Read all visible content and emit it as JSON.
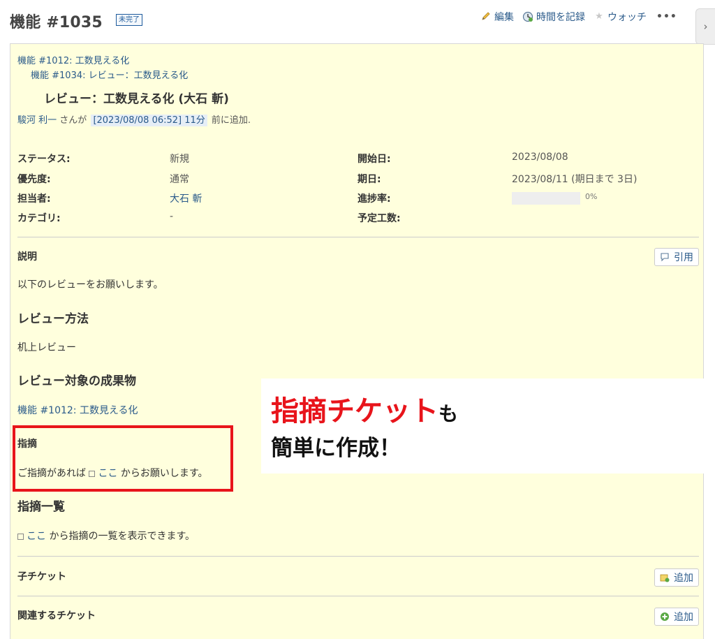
{
  "header": {
    "title": "機能 #1035",
    "status_badge": "未完了"
  },
  "actions": {
    "edit": "編集",
    "log_time": "時間を記録",
    "watch": "ウォッチ",
    "more": "•••"
  },
  "sidebar_toggle": "›",
  "issue": {
    "parents": [
      "機能 #1012: 工数見える化",
      "機能 #1034: レビュー：工数見える化"
    ],
    "subject": "レビュー：工数見える化 (大石 斬)",
    "author": {
      "name": "駿河 利一",
      "san": "さんが",
      "timestamp": "[2023/08/08 06:52] 11分",
      "suffix": "前に追加."
    },
    "attributes": {
      "status_label": "ステータス:",
      "status_value": "新規",
      "priority_label": "優先度:",
      "priority_value": "通常",
      "assignee_label": "担当者:",
      "assignee_value": "大石 斬",
      "category_label": "カテゴリ:",
      "category_value": "-",
      "start_label": "開始日:",
      "start_value": "2023/08/08",
      "due_label": "期日:",
      "due_value": "2023/08/11 (期日まで 3日)",
      "progress_label": "進捗率:",
      "progress_value": "0%",
      "progress_fraction": 0,
      "estimated_label": "予定工数:",
      "estimated_value": ""
    },
    "description": {
      "heading": "説明",
      "quote_button": "引用",
      "intro": "以下のレビューをお願いします。",
      "method_heading": "レビュー方法",
      "method_text": "机上レビュー",
      "target_heading": "レビュー対象の成果物",
      "target_link": "機能 #1012: 工数見える化",
      "remarks_heading": "指摘",
      "remarks_prefix": "ご指摘があれば",
      "remarks_link": "ここ",
      "remarks_suffix": "からお願いします。",
      "list_heading": "指摘一覧",
      "list_link": "ここ",
      "list_suffix": "から指摘の一覧を表示できます。"
    },
    "subtasks": {
      "title": "子チケット",
      "add_button": "追加"
    },
    "relations": {
      "title": "関連するチケット",
      "add_button": "追加"
    }
  },
  "callout": {
    "line1_red": "指摘チケット",
    "line1_black": "も",
    "line2": "簡単に作成！"
  },
  "colors": {
    "accent_red": "#e8141b",
    "link_blue": "#2a5a8a",
    "issue_bg": "#ffffdd"
  }
}
